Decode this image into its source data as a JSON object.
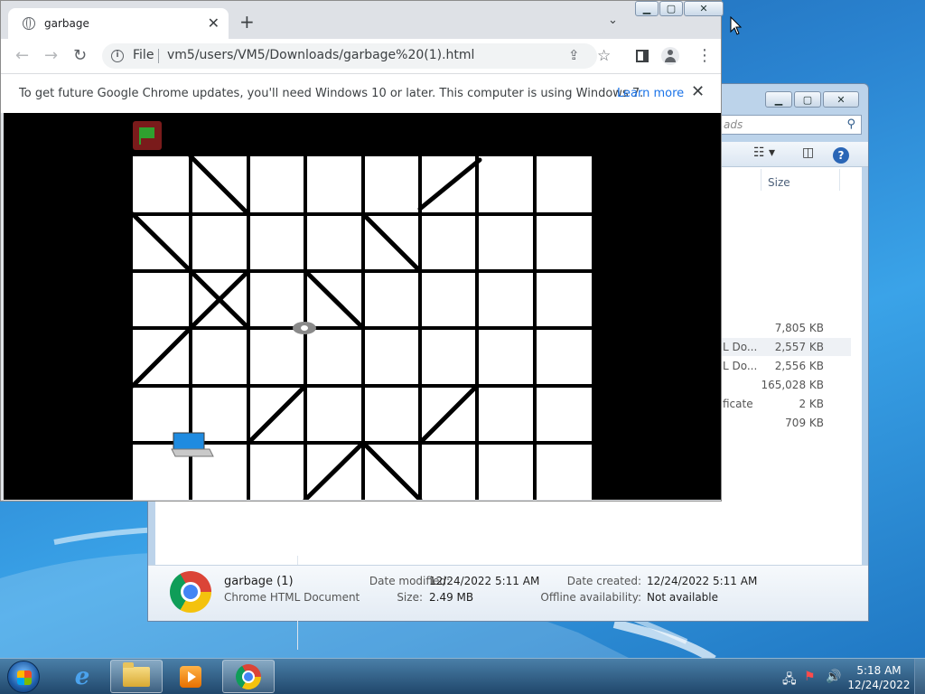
{
  "explorer": {
    "search_placeholder": "ads",
    "columns": {
      "size": "Size"
    },
    "rows": [
      {
        "type": "",
        "size": "7,805 KB"
      },
      {
        "type": "L Do...",
        "size": "2,557 KB",
        "selected": true
      },
      {
        "type": "L Do...",
        "size": "2,556 KB"
      },
      {
        "type": "",
        "size": "165,028 KB"
      },
      {
        "type": "ficate",
        "size": "2 KB"
      },
      {
        "type": "",
        "size": "709 KB"
      }
    ],
    "details": {
      "name": "garbage (1)",
      "filetype": "Chrome HTML Document",
      "date_modified_label": "Date modified:",
      "date_modified": "12/24/2022 5:11 AM",
      "size_label": "Size:",
      "size": "2.49 MB",
      "date_created_label": "Date created:",
      "date_created": "12/24/2022 5:11 AM",
      "offline_label": "Offline availability:",
      "offline": "Not available"
    }
  },
  "chrome": {
    "tab_title": "garbage",
    "url_scheme": "File",
    "url": "vm5/users/VM5/Downloads/garbage%20(1).html",
    "infobar_message": "To get future Google Chrome updates, you'll need Windows 10 or later. This computer is using Windows 7.",
    "infobar_link": "Learn more"
  },
  "game": {
    "grid_cols": 8,
    "grid_rows": 6,
    "flag_color": "#2fa12f",
    "flag_bg": "#7a1b1b"
  },
  "taskbar": {
    "time": "5:18 AM",
    "date": "12/24/2022"
  },
  "colors": {
    "chrome_link": "#1a73e8",
    "desktop": "#2a83d0"
  }
}
